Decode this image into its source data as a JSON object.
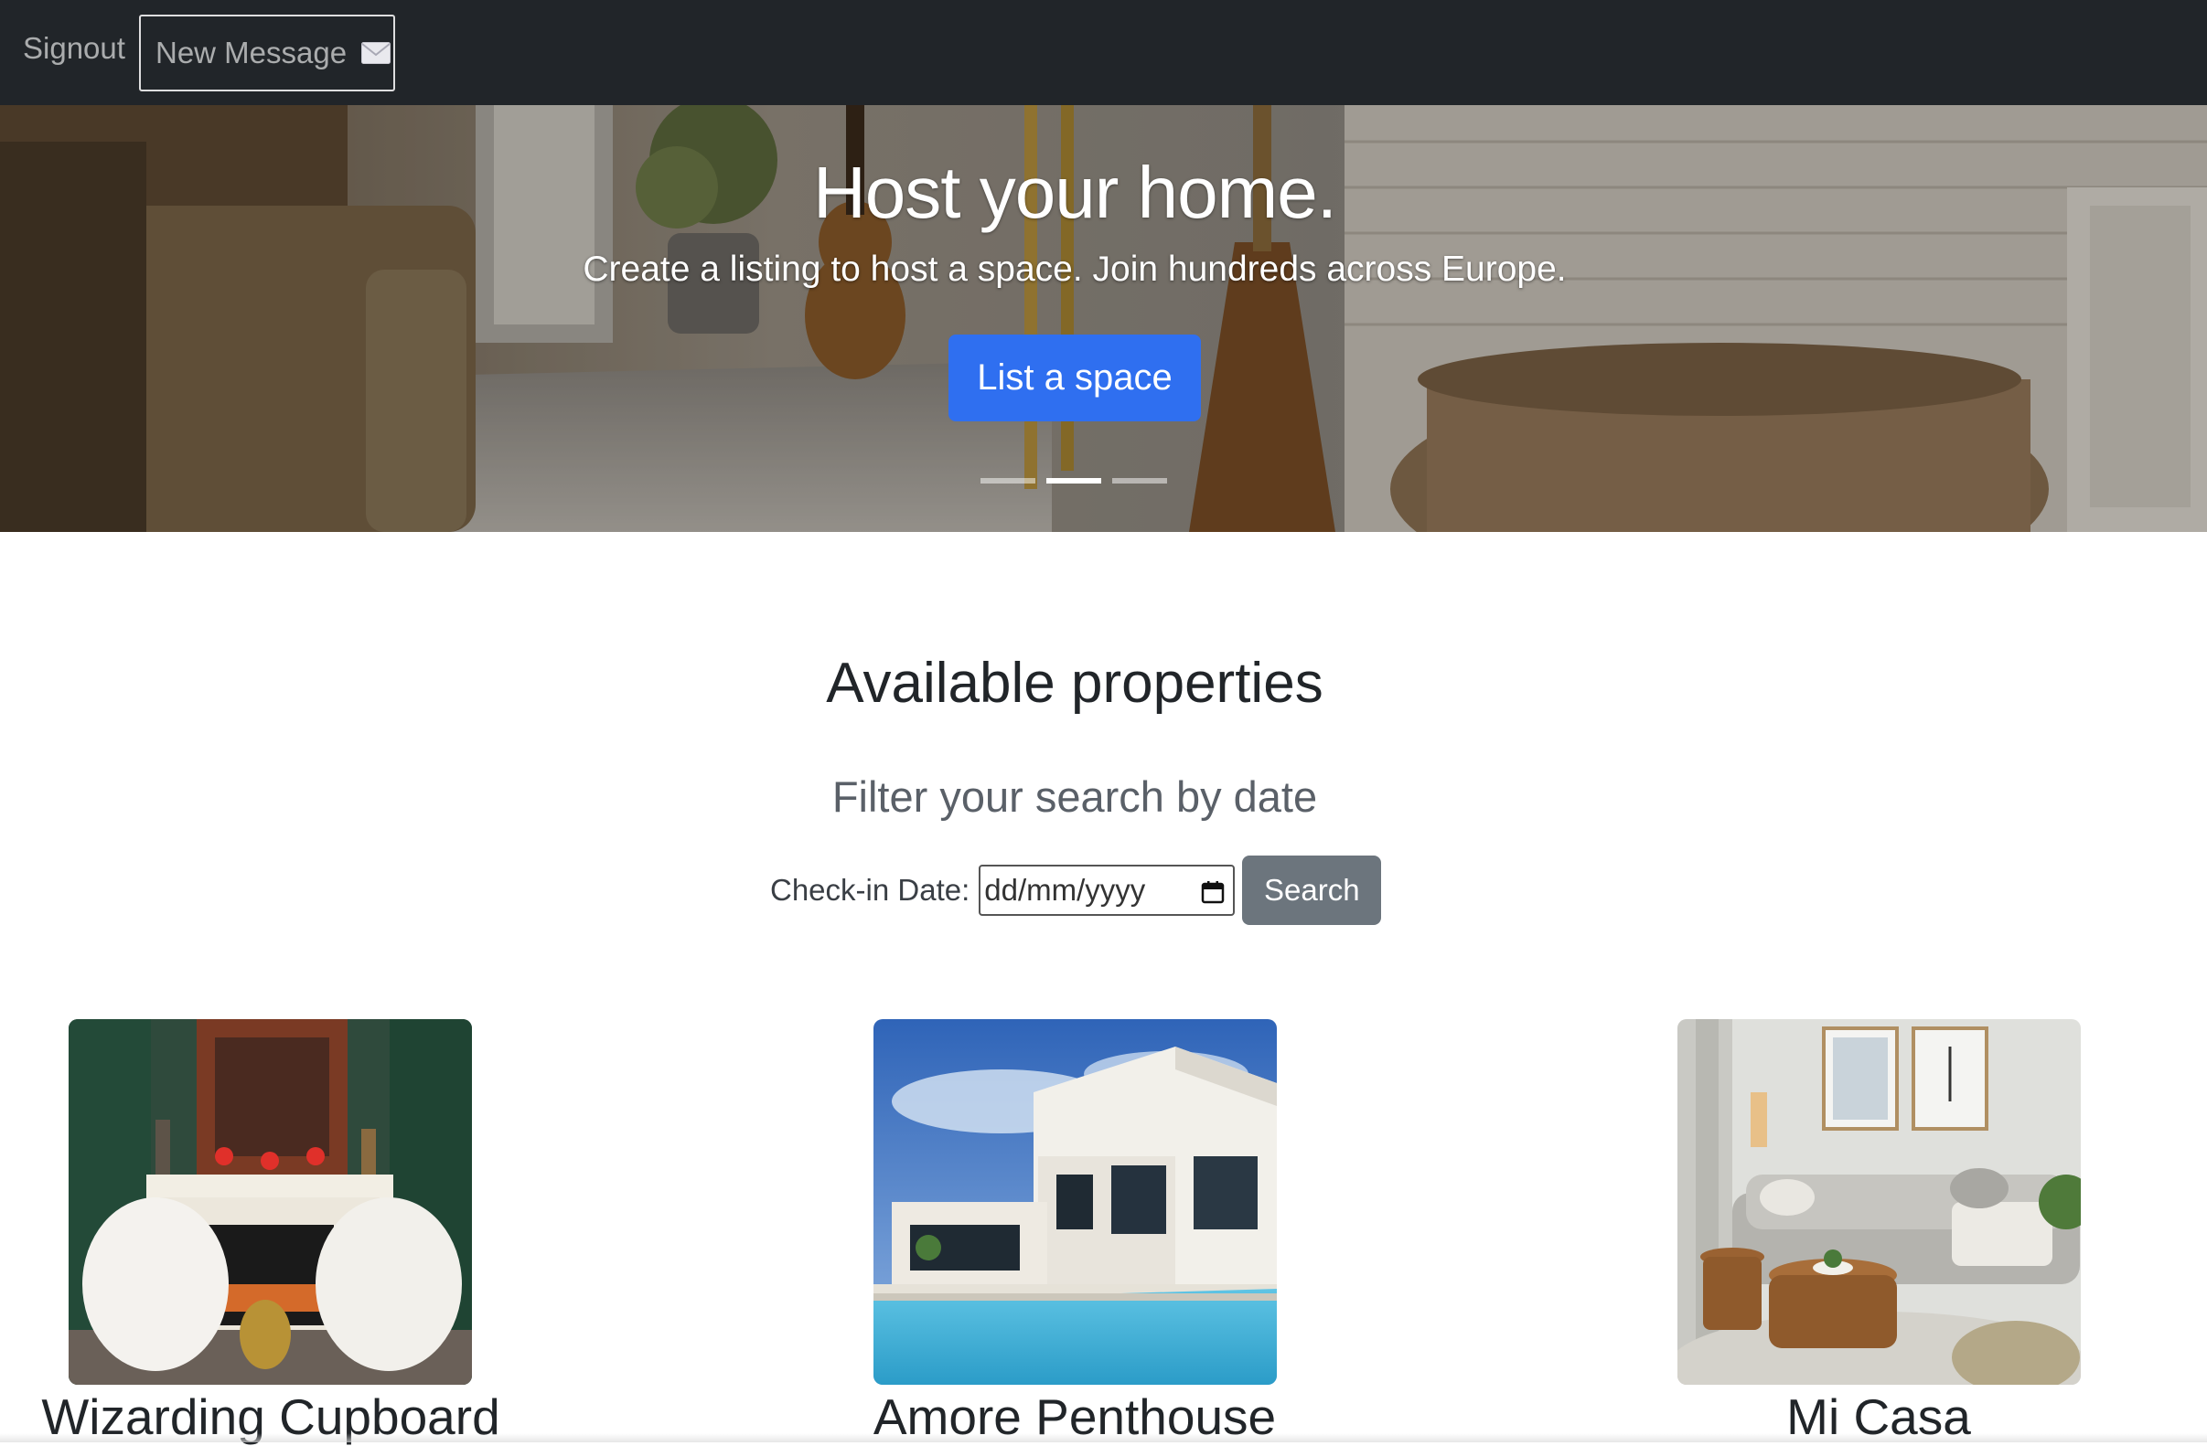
{
  "navbar": {
    "signout_label": "Signout",
    "new_message_label": "New Message",
    "new_message_icon": "envelope-icon",
    "background": "#212529"
  },
  "hero": {
    "title": "Host your home.",
    "subtitle": "Create a listing to host a space. Join hundreds across Europe.",
    "cta_label": "List a space",
    "cta_color": "#2f6ff0",
    "carousel": {
      "slide_count": 3,
      "active_index": 1
    }
  },
  "main": {
    "heading": "Available properties",
    "filter_heading": "Filter your search by date",
    "filter": {
      "label": "Check-in Date:",
      "date_placeholder": "dd/mm/yyyy",
      "date_icon": "calendar-icon",
      "search_label": "Search",
      "search_color": "#6c757d"
    }
  },
  "properties": [
    {
      "name": "Wizarding Cupboard",
      "image": "living-room-fireplace-armchairs"
    },
    {
      "name": "Amore Penthouse",
      "image": "modern-villa-with-pool"
    },
    {
      "name": "Mi Casa",
      "image": "living-room-sofa-coffee-table"
    }
  ]
}
